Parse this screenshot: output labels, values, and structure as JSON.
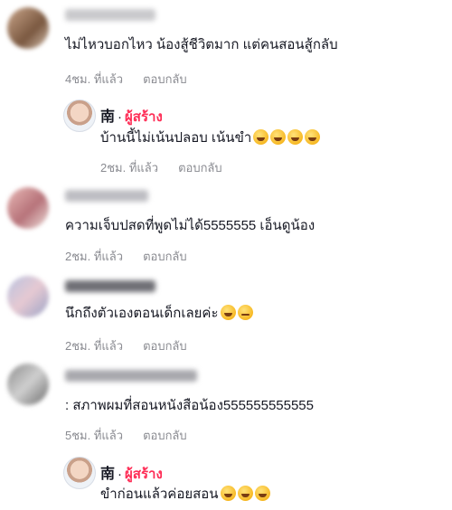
{
  "comments": [
    {
      "text": "ไม่ไหวบอกไหว น้องสู้ชีวิตมาก แต่คนสอนสู้กลับ",
      "time": "4ชม. ที่แล้ว",
      "reply_label": "ตอบกลับ"
    },
    {
      "is_reply": true,
      "author": "南",
      "separator": "·",
      "author_tag": "ผู้สร้าง",
      "text": "บ้านนี้ไม่เน้นปลอบ เน้นขำ",
      "emojis": [
        "sweat-smile-emoji",
        "rofl-emoji",
        "rofl-emoji",
        "rofl-emoji"
      ],
      "time": "2ชม. ที่แล้ว",
      "reply_label": "ตอบกลับ"
    },
    {
      "text": "ความเจ็บปสดที่พูดไม่ได้5555555 เอ็นดูน้อง",
      "time": "2ชม. ที่แล้ว",
      "reply_label": "ตอบกลับ"
    },
    {
      "text": "นึกถึงตัวเองตอนเด็กเลยค่ะ",
      "emojis": [
        "sweat-smile-emoji",
        "frowning-emoji"
      ],
      "time": "2ชม. ที่แล้ว",
      "reply_label": "ตอบกลับ"
    },
    {
      "text": ": สภาพผมที่สอนหนังสือน้อง555555555555",
      "time": "5ชม. ที่แล้ว",
      "reply_label": "ตอบกลับ"
    },
    {
      "is_reply": true,
      "author": "南",
      "separator": "·",
      "author_tag": "ผู้สร้าง",
      "text": "ขำก่อนแล้วค่อยสอน",
      "emojis": [
        "grin-sweat-emoji",
        "grin-sweat-emoji",
        "grin-sweat-emoji"
      ]
    }
  ],
  "colors": {
    "creator_tag": "#fe2c55",
    "meta_text": "#8a8b91",
    "body_text": "#161823"
  }
}
